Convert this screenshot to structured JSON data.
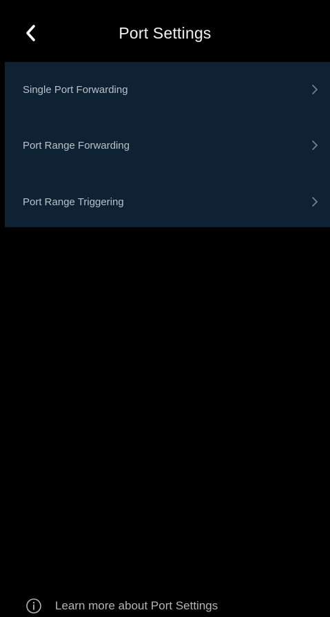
{
  "header": {
    "title": "Port Settings",
    "back_icon": "chevron-left-icon"
  },
  "menu": {
    "background": "#0f2233",
    "items": [
      {
        "label": "Single Port Forwarding",
        "icon": "chevron-right-icon"
      },
      {
        "label": "Port Range Forwarding",
        "icon": "chevron-right-icon"
      },
      {
        "label": "Port Range Triggering",
        "icon": "chevron-right-icon"
      }
    ]
  },
  "footer": {
    "icon": "info-icon",
    "link_text": "Learn more about Port Settings"
  }
}
